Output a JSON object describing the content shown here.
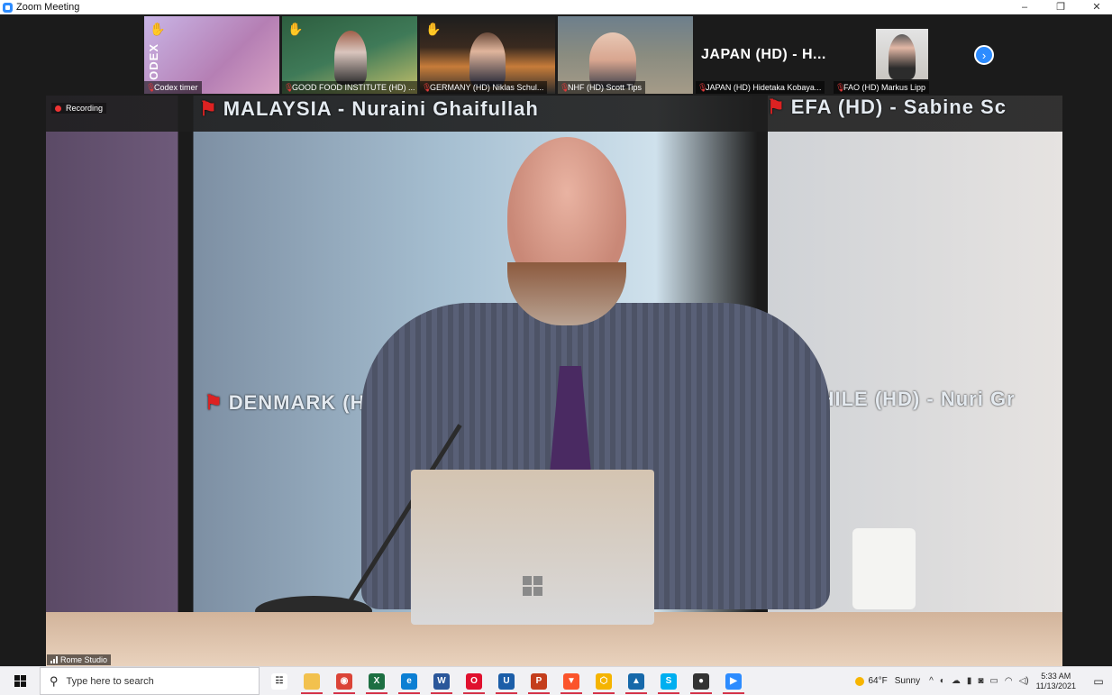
{
  "window": {
    "title": "Zoom Meeting",
    "controls": [
      "–",
      "❐",
      "✕"
    ]
  },
  "recording": {
    "label": "Recording"
  },
  "thumbnails": [
    {
      "key": "codex",
      "label": "Codex timer",
      "muted": true,
      "hand_raised": true,
      "codex_word": "ODEX"
    },
    {
      "key": "gfi",
      "label": "GOOD FOOD INSTITUTE (HD)  ...",
      "muted": true,
      "hand_raised": true
    },
    {
      "key": "germany",
      "label": "GERMANY (HD)  Niklas Schul...",
      "muted": true,
      "hand_raised": true
    },
    {
      "key": "nhf",
      "label": "NHF (HD)   Scott Tips",
      "muted": true,
      "hand_raised": false
    },
    {
      "key": "japan",
      "label": "JAPAN (HD)   Hidetaka Kobaya...",
      "muted": true,
      "hand_raised": false,
      "big_name": "JAPAN (HD) - H..."
    },
    {
      "key": "fao",
      "label": "FAO (HD)   Markus Lipp",
      "muted": true,
      "hand_raised": false
    }
  ],
  "next_icon": "chevron-right-icon",
  "main": {
    "banners": {
      "malaysia": "MALAYSIA - Nuraini Ghaifullah",
      "efa": "EFA (HD) - Sabine Sc",
      "denmark": "DENMARK (H",
      "chile": "CHILE (HD) - Nuri Gr"
    },
    "speaker_label": "Rome Studio"
  },
  "taskbar": {
    "search_placeholder": "Type here to search",
    "icons": [
      {
        "name": "task-view-icon",
        "glyph": "☷",
        "color": "#ffffff",
        "fg": "#333"
      },
      {
        "name": "file-explorer-icon",
        "glyph": "▇",
        "color": "#f2c14e",
        "fg": "#f2c14e",
        "active": true
      },
      {
        "name": "chrome-icon",
        "glyph": "◉",
        "color": "#db4437",
        "fg": "#fff",
        "active": true
      },
      {
        "name": "excel-icon",
        "glyph": "X",
        "color": "#1d6f42",
        "fg": "#fff",
        "active": true
      },
      {
        "name": "edge-icon",
        "glyph": "e",
        "color": "#0c7fd3",
        "fg": "#fff",
        "active": true
      },
      {
        "name": "word-icon",
        "glyph": "W",
        "color": "#2b579a",
        "fg": "#fff",
        "active": true
      },
      {
        "name": "opera-icon",
        "glyph": "O",
        "color": "#e0102e",
        "fg": "#fff",
        "active": true
      },
      {
        "name": "u-app-icon",
        "glyph": "U",
        "color": "#1c5ea8",
        "fg": "#fff",
        "active": true
      },
      {
        "name": "powerpoint-icon",
        "glyph": "P",
        "color": "#c43e1c",
        "fg": "#fff",
        "active": true
      },
      {
        "name": "brave-icon",
        "glyph": "▼",
        "color": "#fb542b",
        "fg": "#fff",
        "active": true
      },
      {
        "name": "hexagon-app-icon",
        "glyph": "⬡",
        "color": "#f5b400",
        "fg": "#fff",
        "active": true
      },
      {
        "name": "photos-icon",
        "glyph": "▲",
        "color": "#1769aa",
        "fg": "#fff",
        "active": true
      },
      {
        "name": "skype-icon",
        "glyph": "S",
        "color": "#00aff0",
        "fg": "#fff",
        "active": true
      },
      {
        "name": "media-player-icon",
        "glyph": "●",
        "color": "#333333",
        "fg": "#fff",
        "active": true
      },
      {
        "name": "zoom-icon",
        "glyph": "▶",
        "color": "#2d8cff",
        "fg": "#fff",
        "active": true
      }
    ],
    "weather": {
      "temp": "64°F",
      "condition": "Sunny"
    },
    "time": "5:33 AM",
    "date": "11/13/2021"
  }
}
